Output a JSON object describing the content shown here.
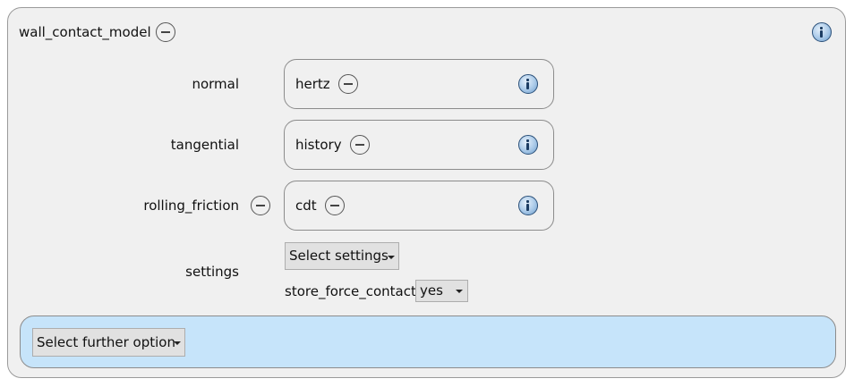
{
  "panel": {
    "title": "wall_contact_model"
  },
  "rows": [
    {
      "label": "normal",
      "value": "hertz"
    },
    {
      "label": "tangential",
      "value": "history"
    },
    {
      "label": "rolling_friction",
      "value": "cdt"
    }
  ],
  "settings": {
    "label": "settings",
    "select_label": "Select settings",
    "store_force_contact": {
      "label": "store_force_contact",
      "value": "yes"
    }
  },
  "further": {
    "select_label": "Select further option"
  },
  "icons": {
    "remove": "minus-circle-icon",
    "info": "info-icon"
  }
}
